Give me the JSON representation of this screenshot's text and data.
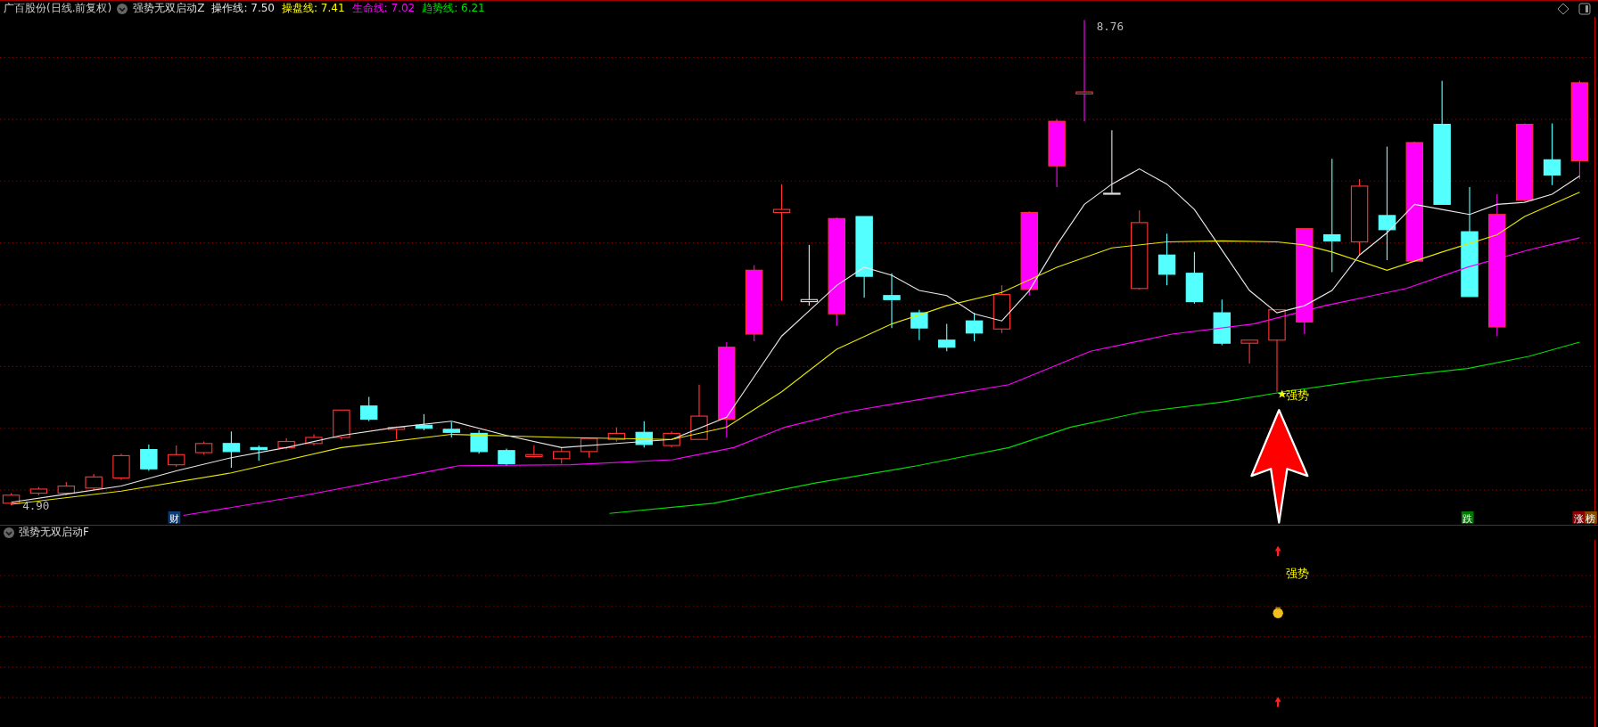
{
  "header": {
    "stock": "广百股份(日线.前复权)",
    "indicator": "强势无双启动Z",
    "lines": [
      {
        "label": "操作线: 7.50",
        "color": "#e6e6e6"
      },
      {
        "label": "操盘线: 7.41",
        "color": "#ffff00"
      },
      {
        "label": "生命线: 7.02",
        "color": "#ff00ff"
      },
      {
        "label": "趋势线: 6.21",
        "color": "#00e000"
      }
    ]
  },
  "main_chart": {
    "high_label": "8.76",
    "low_label": "4.90",
    "signal_label": "强势",
    "tags": [
      {
        "text": "财",
        "color": "#0c3d78"
      },
      {
        "text": "跌",
        "color": "#007a00"
      },
      {
        "text": "涨",
        "color": "#8b0000"
      },
      {
        "text": "榜",
        "color": "#8b4a00"
      }
    ]
  },
  "lower_panel": {
    "title": "强势无双启动F",
    "signal_label": "强势"
  }
}
